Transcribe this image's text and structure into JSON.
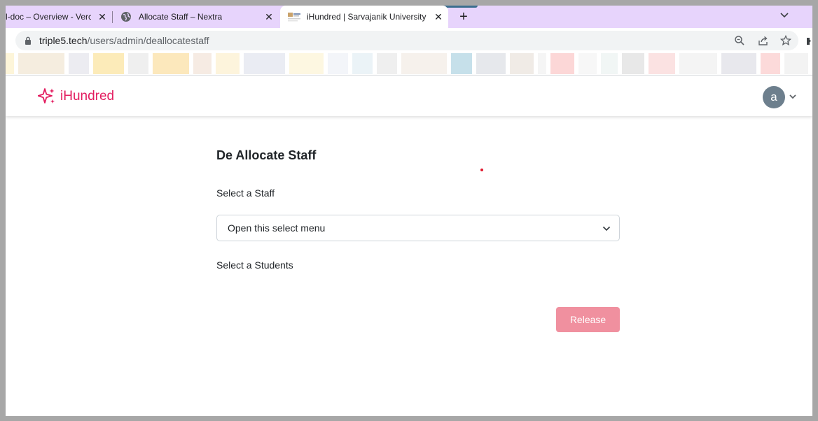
{
  "browser": {
    "tabs": [
      {
        "title": "l-doc – Overview - Vercel",
        "active": false
      },
      {
        "title": "Allocate Staff – Nextra",
        "active": false
      },
      {
        "title": "iHundred | Sarvajanik University",
        "active": true
      }
    ],
    "close_glyph": "✕",
    "new_tab_glyph": "+",
    "url": {
      "host": "triple5.tech",
      "path": "/users/admin/deallocatestaff"
    },
    "bookmark_colors": [
      "#fdf3d2",
      "#f3ead9",
      "#e9e9ee",
      "#fbe7ad",
      "#ececec",
      "#fbe4b0",
      "#f4e8de",
      "#fdf2d6",
      "#e6e9f1",
      "#fdf6dc",
      "#f1f3f8",
      "#e8f1f6",
      "#ececec",
      "#f5efe9",
      "#bcdbe6",
      "#e2e4e9",
      "#ede8e2",
      "#f3f3f3",
      "#fbd0d0",
      "#f6f6f6",
      "#eef4f3",
      "#e4e4e4",
      "#fadddd",
      "#f2f2f2",
      "#e4e4ea",
      "#fbd3d3",
      "#f1f1f1"
    ]
  },
  "app": {
    "brand": "iHundred",
    "accent": "#e31c5f",
    "avatar_letter": "a"
  },
  "page": {
    "heading": "De Allocate Staff",
    "staff_label": "Select a Staff",
    "staff_select": {
      "selected": "Open this select menu"
    },
    "students_label": "Select a Students",
    "release_button": "Release",
    "release_color": "#f0909f"
  }
}
